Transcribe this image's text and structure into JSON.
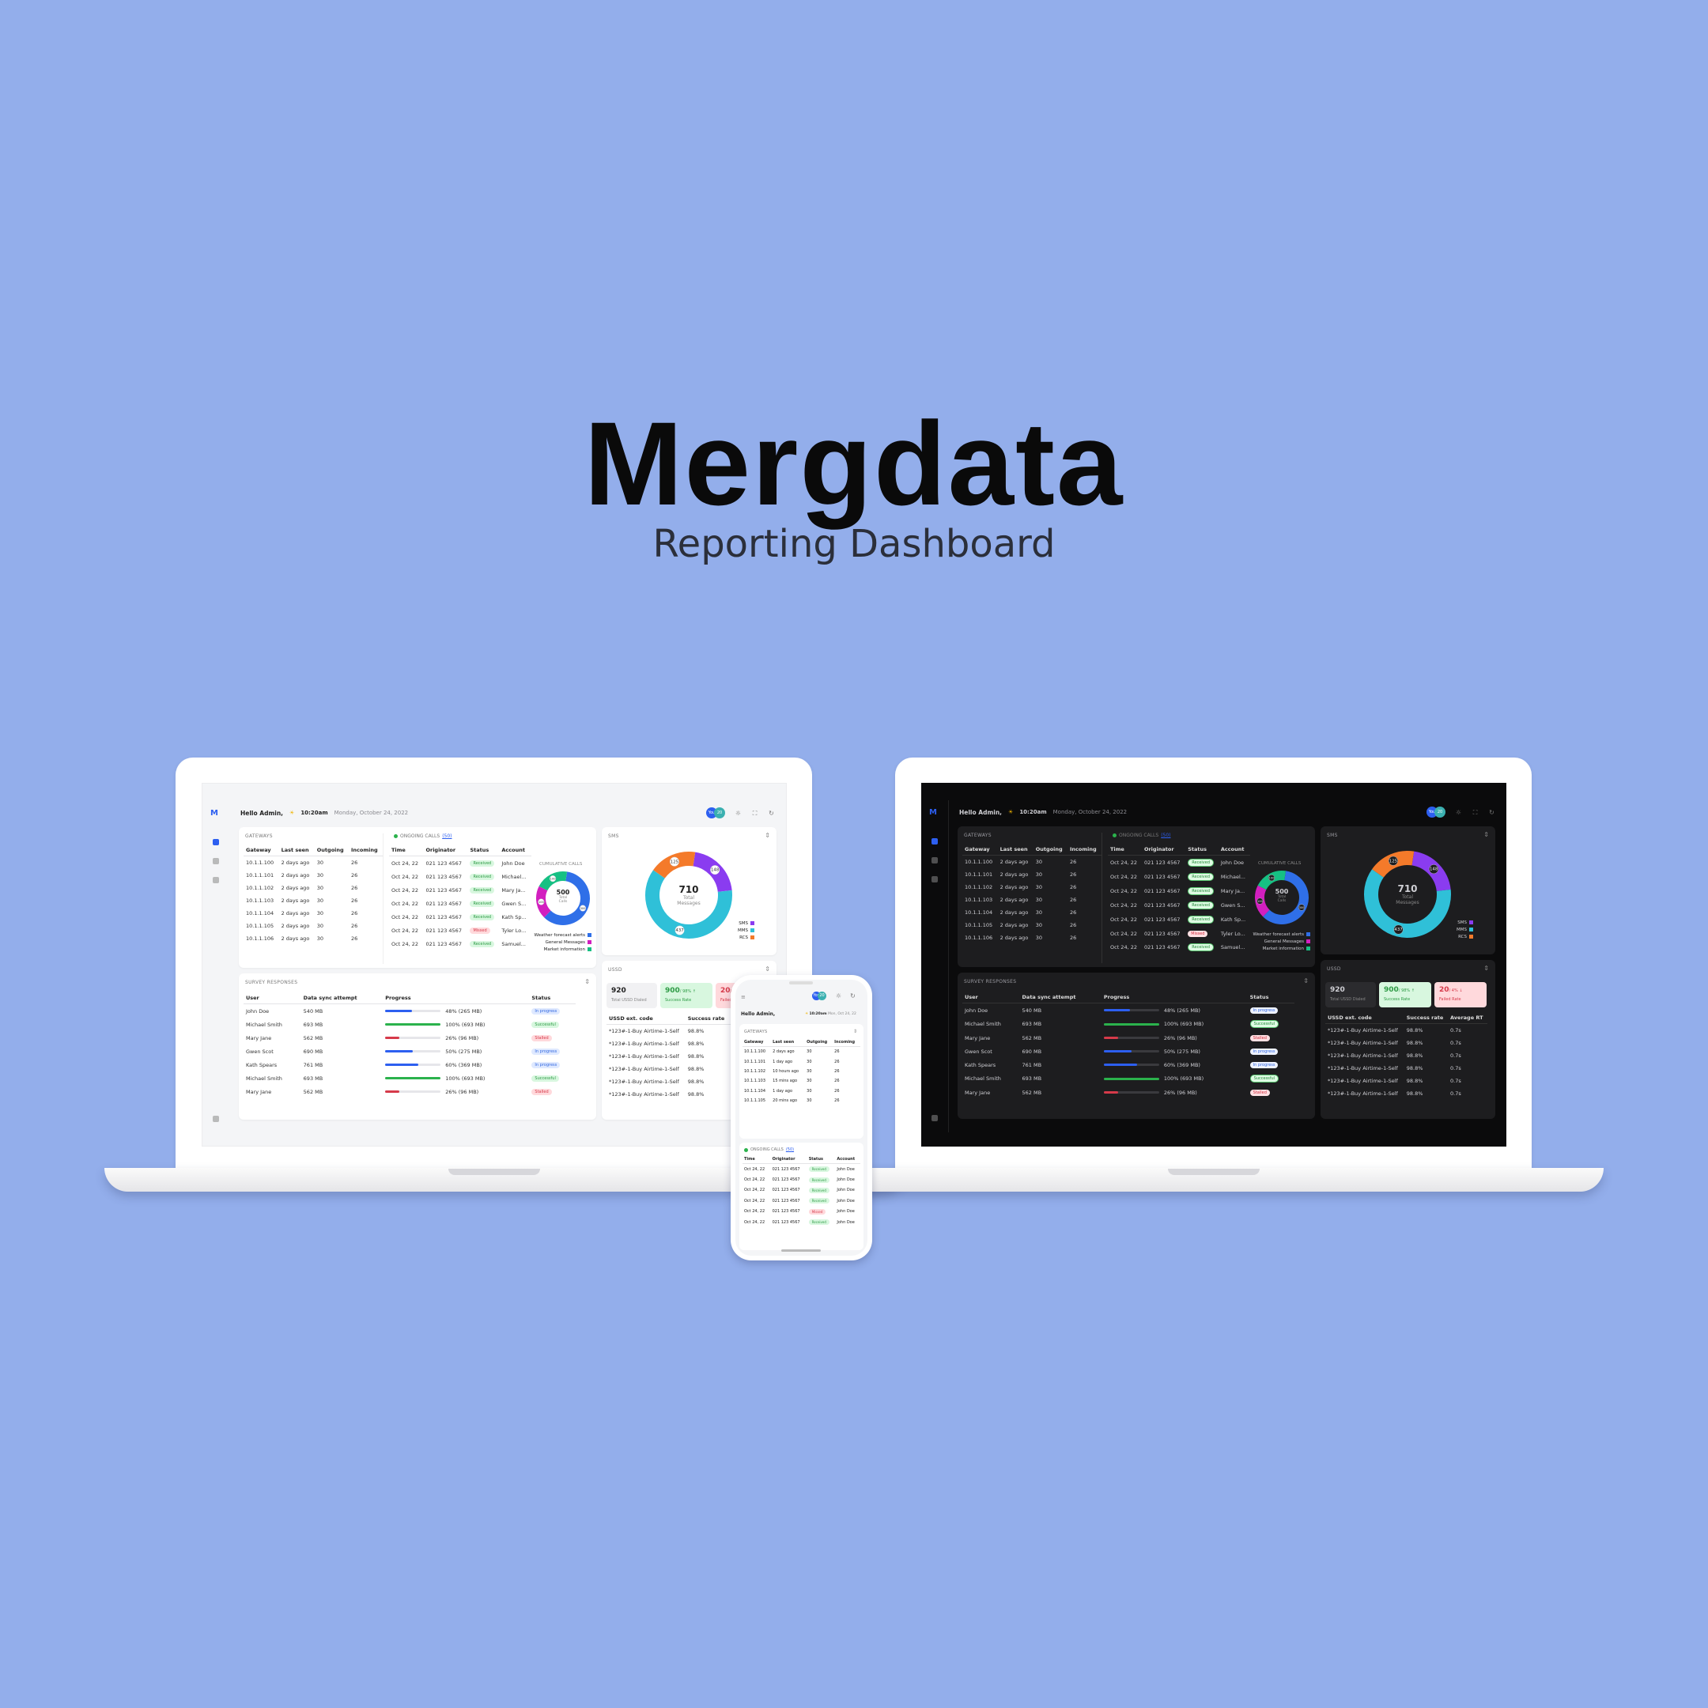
{
  "hero": {
    "title": "Mergdata",
    "subtitle": "Reporting Dashboard"
  },
  "header": {
    "greeting": "Hello Admin,",
    "time": "10:20am",
    "date": "Monday, October 24, 2022",
    "avatar_label": "You",
    "avatar_count": "20"
  },
  "gateways": {
    "title": "GATEWAYS",
    "columns": [
      "Gateway",
      "Last seen",
      "Outgoing",
      "Incoming"
    ],
    "rows": [
      [
        "10.1.1.100",
        "2 days ago",
        "30",
        "26"
      ],
      [
        "10.1.1.101",
        "2 days ago",
        "30",
        "26"
      ],
      [
        "10.1.1.102",
        "2 days ago",
        "30",
        "26"
      ],
      [
        "10.1.1.103",
        "2 days ago",
        "30",
        "26"
      ],
      [
        "10.1.1.104",
        "2 days ago",
        "30",
        "26"
      ],
      [
        "10.1.1.105",
        "2 days ago",
        "30",
        "26"
      ],
      [
        "10.1.1.106",
        "2 days ago",
        "30",
        "26"
      ]
    ]
  },
  "ongoing": {
    "title": "ONGOING CALLS",
    "count": "(50)",
    "columns": [
      "Time",
      "Originator",
      "Status",
      "Account"
    ],
    "rows": [
      [
        "Oct 24, 22",
        "021 123 4567",
        "Received",
        "John Doe"
      ],
      [
        "Oct 24, 22",
        "021 123 4567",
        "Received",
        "Michael..."
      ],
      [
        "Oct 24, 22",
        "021 123 4567",
        "Received",
        "Mary Ja..."
      ],
      [
        "Oct 24, 22",
        "021 123 4567",
        "Received",
        "Gwen S..."
      ],
      [
        "Oct 24, 22",
        "021 123 4567",
        "Received",
        "Kath Sp..."
      ],
      [
        "Oct 24, 22",
        "021 123 4567",
        "Missed",
        "Tyler Lo..."
      ],
      [
        "Oct 24, 22",
        "021 123 4567",
        "Received",
        "Samuel..."
      ]
    ]
  },
  "cumulative": {
    "title": "CUMULATIVE CALLS",
    "total": "500",
    "total_label": "Total Calls",
    "slices": [
      {
        "label": "Weather forecast alerts",
        "value": 300,
        "color": "#2f6fe8"
      },
      {
        "label": "General Messages",
        "value": 100,
        "color": "#d21fbf"
      },
      {
        "label": "Market information",
        "value": 100,
        "color": "#16c083"
      }
    ]
  },
  "sms": {
    "title": "SMS",
    "total": "710",
    "total_label": "Total Messages",
    "slices": [
      {
        "label": "SMS",
        "value": 148,
        "color": "#8a3cf0"
      },
      {
        "label": "MMS",
        "value": 437,
        "color": "#2fc0d8"
      },
      {
        "label": "RCS",
        "value": 125,
        "color": "#f47a2a"
      }
    ]
  },
  "ussd": {
    "title": "USSD",
    "total": "920",
    "total_label": "Total USSD Dialed",
    "success": "900",
    "success_delta": "/ 98% ↑",
    "success_label": "Success Rate",
    "failed": "20",
    "failed_delta": "/ 4% ↓",
    "failed_label": "Failed Rate",
    "columns": [
      "USSD ext. code",
      "Success rate",
      "Average RT"
    ],
    "rows": [
      [
        "*123#-1-Buy Airtime-1-Self",
        "98.8%",
        "0.7s"
      ],
      [
        "*123#-1-Buy Airtime-1-Self",
        "98.8%",
        "0.7s"
      ],
      [
        "*123#-1-Buy Airtime-1-Self",
        "98.8%",
        "0.7s"
      ],
      [
        "*123#-1-Buy Airtime-1-Self",
        "98.8%",
        "0.7s"
      ],
      [
        "*123#-1-Buy Airtime-1-Self",
        "98.8%",
        "0.7s"
      ],
      [
        "*123#-1-Buy Airtime-1-Self",
        "98.8%",
        "0.7s"
      ]
    ]
  },
  "survey": {
    "title": "SURVEY RESPONSES",
    "columns": [
      "User",
      "Data sync attempt",
      "Progress",
      "Status"
    ],
    "rows": [
      {
        "user": "John Doe",
        "size": "540 MB",
        "progress": 0.48,
        "label": "48% (265 MB)",
        "status": "In progress",
        "kind": "prog"
      },
      {
        "user": "Michael Smith",
        "size": "693 MB",
        "progress": 1.0,
        "label": "100% (693 MB)",
        "status": "Successful",
        "kind": "ok"
      },
      {
        "user": "Mary Jane",
        "size": "562 MB",
        "progress": 0.26,
        "label": "26% (96 MB)",
        "status": "Stalled",
        "kind": "bad"
      },
      {
        "user": "Gwen Scot",
        "size": "690 MB",
        "progress": 0.5,
        "label": "50% (275 MB)",
        "status": "In progress",
        "kind": "prog"
      },
      {
        "user": "Kath Spears",
        "size": "761 MB",
        "progress": 0.6,
        "label": "60% (369 MB)",
        "status": "In progress",
        "kind": "prog"
      },
      {
        "user": "Michael Smith",
        "size": "693 MB",
        "progress": 1.0,
        "label": "100% (693 MB)",
        "status": "Successful",
        "kind": "ok"
      },
      {
        "user": "Mary Jane",
        "size": "562 MB",
        "progress": 0.26,
        "label": "26% (96 MB)",
        "status": "Stalled",
        "kind": "bad"
      }
    ]
  },
  "mobile": {
    "greeting": "Hello Admin,",
    "time": "10:20am",
    "date": "Mon, Oct 24, 22",
    "gateways": [
      [
        "10.1.1.100",
        "2 days ago",
        "30",
        "26"
      ],
      [
        "10.1.1.101",
        "1 day ago",
        "30",
        "26"
      ],
      [
        "10.1.1.102",
        "10 hours ago",
        "30",
        "26"
      ],
      [
        "10.1.1.103",
        "15 mins ago",
        "30",
        "26"
      ],
      [
        "10.1.1.104",
        "1 day ago",
        "30",
        "26"
      ],
      [
        "10.1.1.105",
        "20 mins ago",
        "30",
        "26"
      ]
    ],
    "calls": [
      [
        "Oct 24, 22",
        "021 123 4567",
        "Received",
        "John Doe"
      ],
      [
        "Oct 24, 22",
        "021 123 4567",
        "Received",
        "John Doe"
      ],
      [
        "Oct 24, 22",
        "021 123 4567",
        "Received",
        "John Doe"
      ],
      [
        "Oct 24, 22",
        "021 123 4567",
        "Received",
        "John Doe"
      ],
      [
        "Oct 24, 22",
        "021 123 4567",
        "Missed",
        "John Doe"
      ],
      [
        "Oct 24, 22",
        "021 123 4567",
        "Received",
        "John Doe"
      ]
    ]
  },
  "colors": {
    "accent": "#2d5ff0",
    "background": "#93aeeb",
    "success": "#2bb24c",
    "danger": "#d63a4a"
  }
}
